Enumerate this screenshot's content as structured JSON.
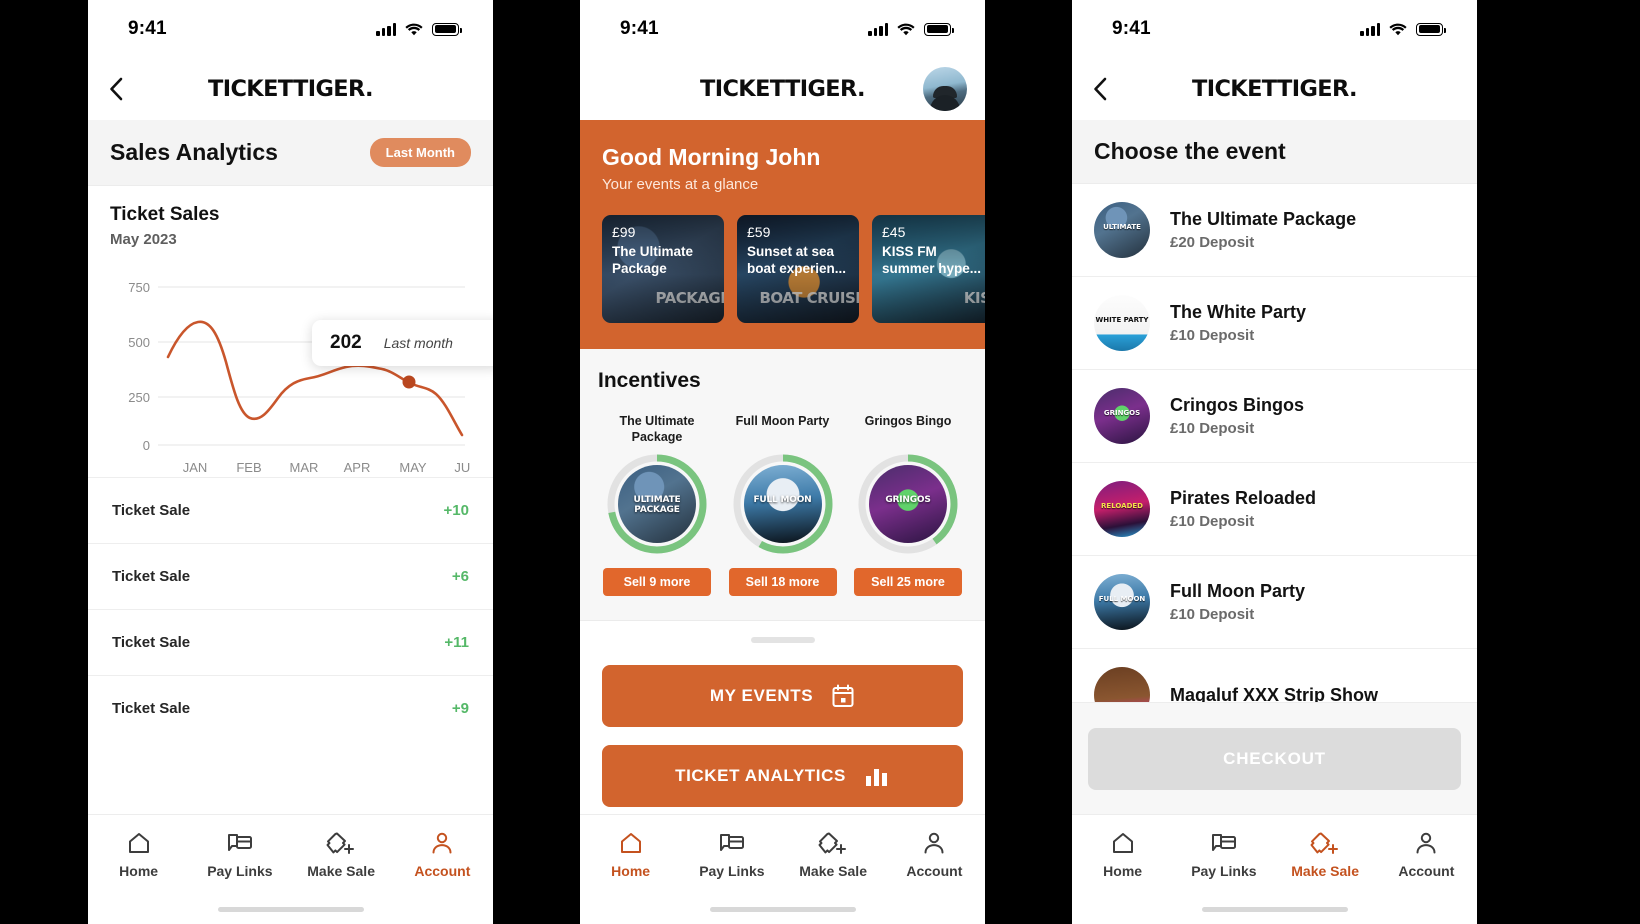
{
  "brand": "TICKETTIGER.",
  "statusbar": {
    "time": "9:41",
    "signal_icon": "cellular-bars-icon",
    "wifi_icon": "wifi-icon",
    "battery_icon": "battery-full-icon"
  },
  "colors": {
    "orange": "#d2642e",
    "orange_light": "#e08b5e",
    "orange_btn": "#e1672c",
    "green_ring": "#7ac47f",
    "green_text": "#55b868",
    "disabled": "#dcdcdc"
  },
  "phone1": {
    "back_icon": "chevron-left-icon",
    "section_title": "Sales Analytics",
    "period_pill": "Last Month",
    "card_title": "Ticket Sales",
    "card_subtitle": "May 2023",
    "tooltip": {
      "value": "202",
      "label": "Last month"
    },
    "sales": [
      {
        "label": "Ticket Sale",
        "amount": "+10"
      },
      {
        "label": "Ticket Sale",
        "amount": "+6"
      },
      {
        "label": "Ticket Sale",
        "amount": "+11"
      },
      {
        "label": "Ticket Sale",
        "amount": "+9"
      }
    ],
    "tabs": [
      {
        "label": "Home",
        "icon": "home-icon",
        "active": false
      },
      {
        "label": "Pay Links",
        "icon": "pay-links-icon",
        "active": false
      },
      {
        "label": "Make Sale",
        "icon": "ticket-plus-icon",
        "active": false
      },
      {
        "label": "Account",
        "icon": "person-icon",
        "active": true
      }
    ]
  },
  "phone2": {
    "avatar_icon": "user-avatar-photo",
    "greeting": "Good Morning John",
    "greeting_sub": "Your events at a glance",
    "event_cards": [
      {
        "price": "£99",
        "name": "The Ultimate Package",
        "watermark": "PACKAGE"
      },
      {
        "price": "£59",
        "name": "Sunset at sea boat experien...",
        "watermark": "BOAT CRUISE"
      },
      {
        "price": "£45",
        "name": "KISS FM summer hype...",
        "watermark": "KISS"
      }
    ],
    "incentives_title": "Incentives",
    "incentives": [
      {
        "name": "The Ultimate Package",
        "button": "Sell 9 more",
        "progress": 72,
        "badge": "ULTIMATE PACKAGE"
      },
      {
        "name": "Full Moon Party",
        "button": "Sell 18 more",
        "progress": 58,
        "badge": "FULL MOON"
      },
      {
        "name": "Gringos Bingo",
        "button": "Sell 25 more",
        "progress": 40,
        "badge": "GRINGOS"
      }
    ],
    "actions": [
      {
        "label": "MY EVENTS",
        "icon": "calendar-icon"
      },
      {
        "label": "TICKET ANALYTICS",
        "icon": "bar-chart-icon"
      }
    ],
    "tabs": [
      {
        "label": "Home",
        "icon": "home-icon",
        "active": true
      },
      {
        "label": "Pay Links",
        "icon": "pay-links-icon",
        "active": false
      },
      {
        "label": "Make Sale",
        "icon": "ticket-plus-icon",
        "active": false
      },
      {
        "label": "Account",
        "icon": "person-icon",
        "active": false
      }
    ]
  },
  "phone3": {
    "back_icon": "chevron-left-icon",
    "section_title": "Choose the event",
    "events": [
      {
        "name": "The Ultimate Package",
        "deposit": "£20 Deposit",
        "badge": "ULTIMATE"
      },
      {
        "name": "The White Party",
        "deposit": "£10 Deposit",
        "badge": "WHITE PARTY"
      },
      {
        "name": "Cringos Bingos",
        "deposit": "£10 Deposit",
        "badge": "GRINGOS"
      },
      {
        "name": "Pirates Reloaded",
        "deposit": "£10 Deposit",
        "badge": "RELOADED"
      },
      {
        "name": "Full Moon Party",
        "deposit": "£10 Deposit",
        "badge": "FULL MOON"
      },
      {
        "name": "Magaluf XXX Strip Show",
        "deposit": "",
        "badge": ""
      }
    ],
    "checkout_label": "CHECKOUT",
    "tabs": [
      {
        "label": "Home",
        "icon": "home-icon",
        "active": false
      },
      {
        "label": "Pay Links",
        "icon": "pay-links-icon",
        "active": false
      },
      {
        "label": "Make Sale",
        "icon": "ticket-plus-icon",
        "active": true
      },
      {
        "label": "Account",
        "icon": "person-icon",
        "active": false
      }
    ]
  },
  "chart_data": {
    "type": "line",
    "title": "Ticket Sales",
    "subtitle": "May 2023",
    "xlabel": "",
    "ylabel": "",
    "categories": [
      "JAN",
      "FEB",
      "MAR",
      "APR",
      "MAY",
      "JUN"
    ],
    "x": [
      "JAN",
      "FEB",
      "MAR",
      "APR",
      "MAY",
      "JUN"
    ],
    "values": [
      540,
      200,
      310,
      370,
      350,
      100
    ],
    "series": [
      {
        "name": "Ticket Sales",
        "values": [
          540,
          200,
          310,
          370,
          350,
          100
        ],
        "color": "#c9562c"
      }
    ],
    "yticks": [
      0,
      250,
      500,
      750
    ],
    "ylim": [
      0,
      800
    ],
    "grid": true,
    "legend": false,
    "highlight": {
      "category": "MAY",
      "value": 202,
      "label": "Last month"
    }
  }
}
